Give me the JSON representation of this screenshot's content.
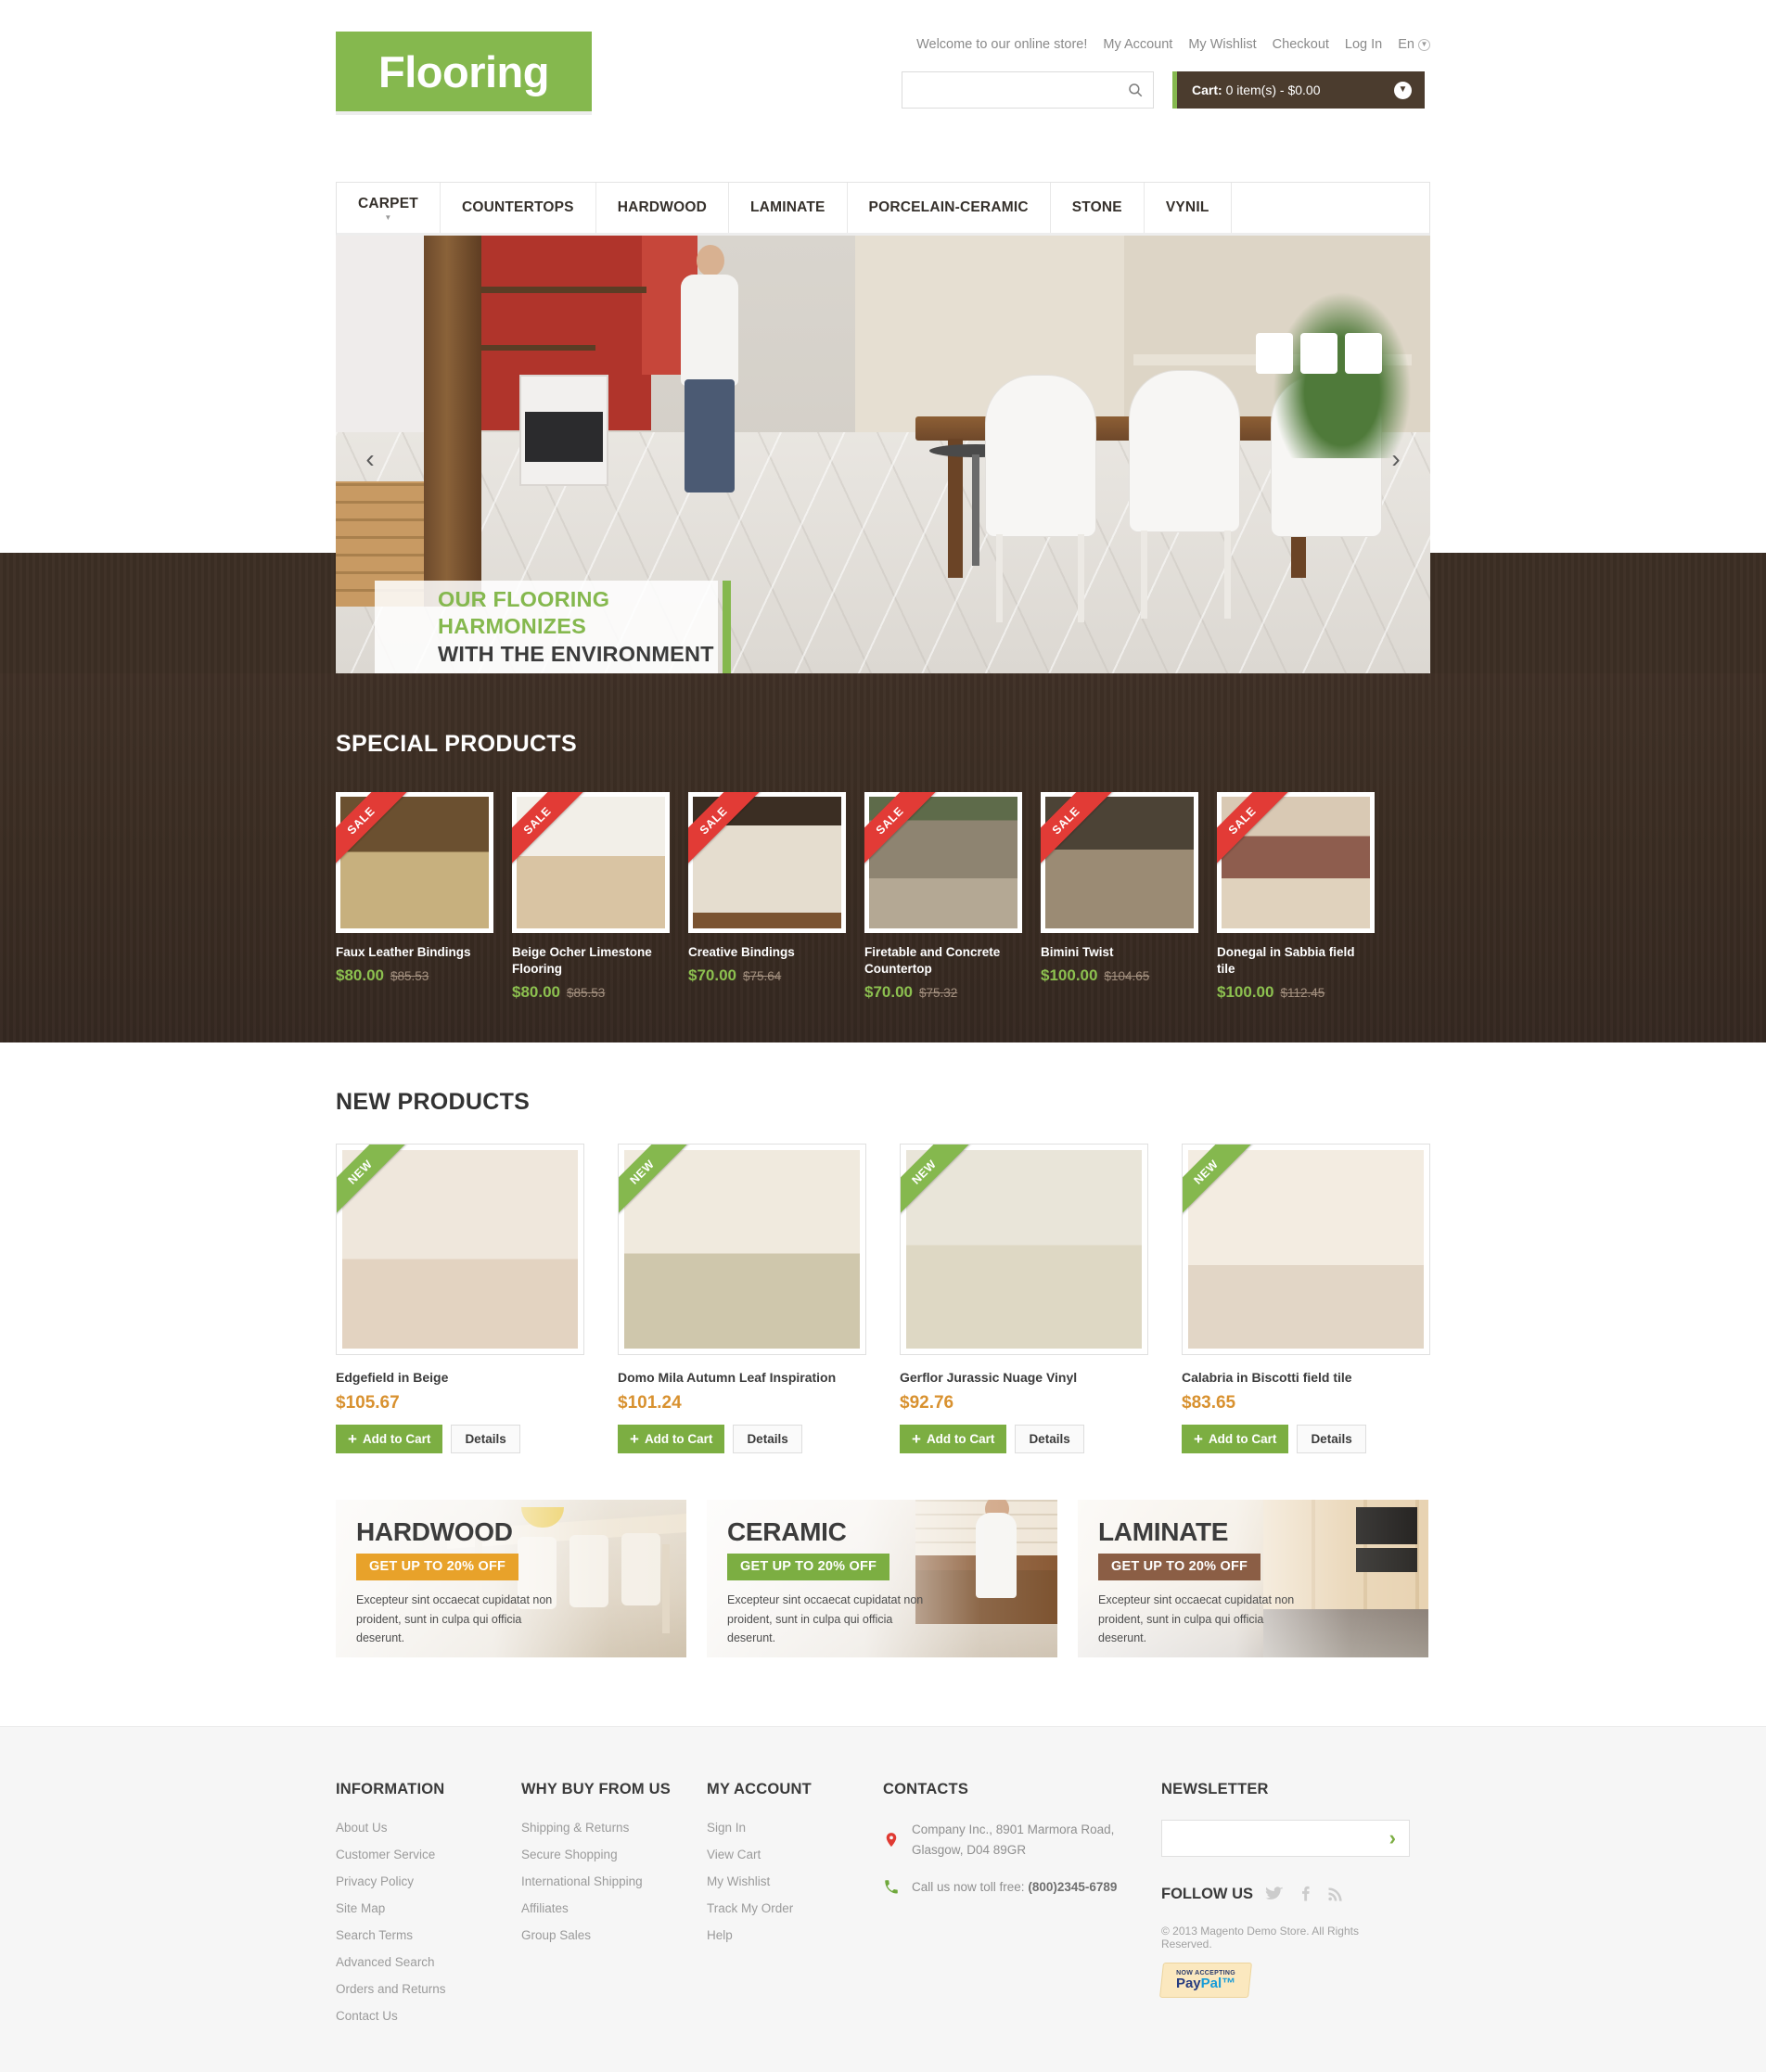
{
  "header": {
    "logo": "Flooring",
    "welcome": "Welcome to our online store!",
    "links": [
      {
        "label": "My Account"
      },
      {
        "label": "My Wishlist"
      },
      {
        "label": "Checkout"
      },
      {
        "label": "Log In"
      }
    ],
    "language": "En",
    "search_placeholder": "",
    "search_value": "",
    "cart_label": "Cart:",
    "cart_summary": "0 item(s) - $0.00"
  },
  "nav": [
    {
      "label": "CARPET",
      "has_dropdown": true
    },
    {
      "label": "COUNTERTOPS",
      "has_dropdown": false
    },
    {
      "label": "HARDWOOD",
      "has_dropdown": false
    },
    {
      "label": "LAMINATE",
      "has_dropdown": false
    },
    {
      "label": "PORCELAIN-CERAMIC",
      "has_dropdown": false
    },
    {
      "label": "STONE",
      "has_dropdown": false
    },
    {
      "label": "VYNIL",
      "has_dropdown": false
    }
  ],
  "hero": {
    "caption_line1": "OUR FLOORING HARMONIZES",
    "caption_line2": "WITH THE ENVIRONMENT",
    "prev": "‹",
    "next": "›",
    "accent_color": "#85b84e"
  },
  "special": {
    "title": "SPECIAL PRODUCTS",
    "badge": "SALE",
    "items": [
      {
        "name": "Faux Leather Bindings",
        "price": "$80.00",
        "old_price": "$85.53"
      },
      {
        "name": "Beige Ocher Limestone Flooring",
        "price": "$80.00",
        "old_price": "$85.53"
      },
      {
        "name": "Creative Bindings",
        "price": "$70.00",
        "old_price": "$75.64"
      },
      {
        "name": "Firetable and Concrete Countertop",
        "price": "$70.00",
        "old_price": "$75.32"
      },
      {
        "name": "Bimini Twist",
        "price": "$100.00",
        "old_price": "$104.65"
      },
      {
        "name": "Donegal in Sabbia field tile",
        "price": "$100.00",
        "old_price": "$112.45"
      }
    ]
  },
  "new_products": {
    "title": "NEW PRODUCTS",
    "badge": "NEW",
    "add_to_cart": "Add to Cart",
    "details": "Details",
    "items": [
      {
        "name": "Edgefield in Beige",
        "price": "$105.67"
      },
      {
        "name": "Domo Mila Autumn Leaf Inspiration",
        "price": "$101.24"
      },
      {
        "name": "Gerflor Jurassic Nuage Vinyl",
        "price": "$92.76"
      },
      {
        "name": "Calabria in Biscotti field tile",
        "price": "$83.65"
      }
    ]
  },
  "promos": [
    {
      "title": "HARDWOOD",
      "badge": "GET UP TO 20% OFF",
      "badge_color": "#e8a22a",
      "text": "Excepteur sint occaecat cupidatat non proident, sunt in culpa qui officia deserunt."
    },
    {
      "title": "CERAMIC",
      "badge": "GET UP TO 20% OFF",
      "badge_color": "#7cae42",
      "text": "Excepteur sint occaecat cupidatat non proident, sunt in culpa qui officia deserunt."
    },
    {
      "title": "LAMINATE",
      "badge": "GET UP TO 20% OFF",
      "badge_color": "#8b5e45",
      "text": "Excepteur sint occaecat cupidatat non proident, sunt in culpa qui officia deserunt."
    }
  ],
  "footer": {
    "information": {
      "title": "INFORMATION",
      "links": [
        {
          "label": "About Us"
        },
        {
          "label": "Customer Service"
        },
        {
          "label": "Privacy Policy"
        },
        {
          "label": "Site Map"
        },
        {
          "label": "Search Terms"
        },
        {
          "label": "Advanced Search"
        },
        {
          "label": "Orders and Returns"
        },
        {
          "label": "Contact Us"
        }
      ]
    },
    "why_buy": {
      "title": "WHY BUY FROM US",
      "links": [
        {
          "label": "Shipping & Returns"
        },
        {
          "label": "Secure Shopping"
        },
        {
          "label": "International Shipping"
        },
        {
          "label": "Affiliates"
        },
        {
          "label": "Group Sales"
        }
      ]
    },
    "my_account": {
      "title": "MY ACCOUNT",
      "links": [
        {
          "label": "Sign In"
        },
        {
          "label": "View Cart"
        },
        {
          "label": "My Wishlist"
        },
        {
          "label": "Track My Order"
        },
        {
          "label": "Help"
        }
      ]
    },
    "contacts": {
      "title": "CONTACTS",
      "address": "Company Inc., 8901 Marmora Road, Glasgow, D04 89GR",
      "phone_label": "Call us now toll free:",
      "phone": "(800)2345-6789"
    },
    "newsletter": {
      "title": "NEWSLETTER",
      "placeholder": "",
      "value": "",
      "submit": "›"
    },
    "follow": {
      "label": "FOLLOW US",
      "icons": [
        "twitter-icon",
        "facebook-icon",
        "rss-icon"
      ]
    },
    "copyright": "© 2013 Magento Demo Store. All Rights Reserved.",
    "paypal": {
      "top": "NOW ACCEPTING",
      "pay": "Pay",
      "pal": "Pal™"
    }
  }
}
